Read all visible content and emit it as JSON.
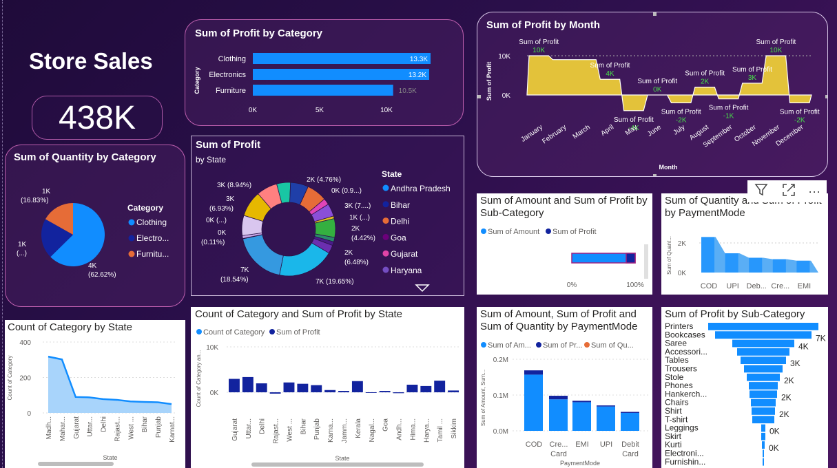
{
  "dashboard": {
    "title": "Store Sales",
    "kpi_value": "438K"
  },
  "icons": {
    "filter": "filter-icon",
    "focus": "focus-mode-icon",
    "more": "more-options-icon",
    "more_label": "···"
  },
  "colors": {
    "primary": "#118DFF",
    "navy": "#12239E",
    "orange": "#E66C37",
    "gold": "#E3C23A",
    "green": "#48E048"
  },
  "chart_data": [
    {
      "id": "profit_by_category",
      "type": "bar",
      "title": "Sum of Profit by Category",
      "ylabel": "Category",
      "categories": [
        "Clothing",
        "Electronics",
        "Furniture"
      ],
      "values": [
        13.3,
        13.2,
        10.5
      ],
      "data_labels": [
        "13.3K",
        "13.2K",
        "10.5K"
      ],
      "xticks": [
        "0K",
        "5K",
        "10K"
      ],
      "xlim": [
        0,
        13.3
      ]
    },
    {
      "id": "profit_by_month",
      "type": "area",
      "title": "Sum of Profit by Month",
      "xlabel": "Month",
      "ylabel": "Sum of Profit",
      "categories": [
        "January",
        "February",
        "March",
        "April",
        "May",
        "June",
        "July",
        "August",
        "September",
        "October",
        "November",
        "December"
      ],
      "values": [
        10,
        9,
        9,
        4,
        -4,
        0,
        -2,
        2,
        -1,
        3,
        10,
        -2
      ],
      "data_labels": [
        "10K",
        "",
        "",
        "4K",
        "-4K",
        "0K",
        "-2K",
        "2K",
        "-1K",
        "3K",
        "10K",
        "-2K"
      ],
      "annotations": [
        "Sum of Profit",
        "Sum of Profit",
        "Sum of Profit",
        "Sum of Profit",
        "Sum of Profit",
        "Sum of Profit",
        "Sum of Profit",
        "Sum of Profit",
        "Sum of Profit",
        "Sum of Profit"
      ],
      "yticks": [
        "10K",
        "0K"
      ],
      "grid": true
    },
    {
      "id": "quantity_by_category",
      "type": "pie",
      "title": "Sum of Quantity by Category",
      "legend_title": "Category",
      "labels": [
        "Clothing",
        "Electro...",
        "Furnitu..."
      ],
      "values": [
        62.62,
        20.55,
        16.83
      ],
      "data_labels": [
        "4K (62.62%)",
        "1K (...)",
        "1K (16.83%)"
      ]
    },
    {
      "id": "profit_by_state",
      "type": "pie",
      "title": "Sum of Profit",
      "subtitle": "by State",
      "legend_title": "State",
      "legend": [
        "Andhra Pradesh",
        "Bihar",
        "Delhi",
        "Goa",
        "Gujarat",
        "Haryana"
      ],
      "values": [
        19.65,
        18.54,
        6.93,
        8.94,
        4.76,
        6.48,
        4.42,
        0.9,
        0.11,
        2.5,
        3.0,
        2.2,
        1.6,
        3.0,
        5.0,
        4.0,
        7.95
      ],
      "data_labels": [
        "2K (4.76%)",
        "0K (0.9...)",
        "3K (7....)",
        "1K (...)",
        "2K (4.42%)",
        "2K (6.48%)",
        "7K (19.65%)",
        "7K (18.54%)",
        "0K (0.11%)",
        "0K (...)",
        "3K (6.93%)",
        "3K (8.94%)"
      ]
    },
    {
      "id": "amount_profit_by_subcategory",
      "type": "bar",
      "title": "Sum of Amount and Sum of Profit by Sub-Category",
      "legend": [
        "Sum of Amount",
        "Sum of Profit"
      ],
      "values": [
        1.0
      ],
      "xticks": [
        "0%",
        "100%"
      ]
    },
    {
      "id": "quantity_profit_by_paymentmode",
      "type": "area",
      "title": "Sum of Quantity and Sum of Profit by PaymentMode",
      "ylabel": "Sum of Quant...",
      "categories": [
        "COD",
        "UPI",
        "Deb...",
        "Cre...",
        "EMI"
      ],
      "values": [
        2.4,
        1.3,
        1.0,
        0.9,
        0.8
      ],
      "yticks": [
        "2K",
        "0K"
      ]
    },
    {
      "id": "count_by_state",
      "type": "area",
      "title": "Count of Category by State",
      "xlabel": "State",
      "ylabel": "Count of Category",
      "categories": [
        "Madh...",
        "Mahar...",
        "Gujarat",
        "Uttar...",
        "Delhi",
        "Rajast...",
        "West ...",
        "Bihar",
        "Punjab",
        "Karnat..."
      ],
      "values": [
        318,
        302,
        90,
        88,
        78,
        74,
        65,
        62,
        60,
        50
      ],
      "yticks": [
        "400",
        "200",
        "0"
      ],
      "ylim": [
        0,
        400
      ]
    },
    {
      "id": "count_profit_by_state",
      "type": "bar",
      "title": "Count of Category and Sum of Profit by State",
      "xlabel": "State",
      "ylabel": "Count of Category an...",
      "legend": [
        "Count of Category",
        "Sum of Profit"
      ],
      "categories": [
        "Gujarat",
        "Uttar...",
        "Delhi",
        "Rajast...",
        "West ...",
        "Bihar",
        "Punjab",
        "Karna...",
        "Jamm...",
        "Kerala",
        "Nagal...",
        "Goa",
        "Andh...",
        "Hima...",
        "Harya...",
        "Tamil ...",
        "Sikkim"
      ],
      "values": [
        3.0,
        3.4,
        2.0,
        -0.3,
        2.2,
        1.9,
        1.6,
        0.5,
        0.3,
        2.5,
        -0.1,
        0.3,
        -0.2,
        1.7,
        1.4,
        2.6,
        0.4
      ],
      "yticks": [
        "10K",
        "0K"
      ]
    },
    {
      "id": "amount_profit_qty_by_paymentmode",
      "type": "bar",
      "title": "Sum of Amount, Sum of Profit and Sum of Quantity by PaymentMode",
      "xlabel": "PaymentMode",
      "ylabel": "Sum of Amount, Sum...",
      "legend": [
        "Sum of Am...",
        "Sum of Pr...",
        "Sum of Qu..."
      ],
      "categories": [
        "COD",
        "Cre... Card",
        "EMI",
        "UPI",
        "Debit Card"
      ],
      "series": [
        {
          "name": "Sum of Amount",
          "values": [
            1.57,
            0.88,
            0.8,
            0.68,
            0.5
          ]
        },
        {
          "name": "Sum of Profit",
          "values": [
            0.12,
            0.1,
            0.04,
            0.03,
            0.03
          ]
        }
      ],
      "yticks": [
        "0.2M",
        "0.1M",
        "0.0M"
      ],
      "ylim": [
        0,
        0.2
      ]
    },
    {
      "id": "profit_by_subcategory",
      "type": "bar",
      "title": "Sum of Profit by Sub-Category",
      "categories": [
        "Printers",
        "Bookcases",
        "Saree",
        "Accessori...",
        "Tables",
        "Trousers",
        "Stole",
        "Phones",
        "Hankerch...",
        "Chairs",
        "Shirt",
        "T-shirt",
        "Leggings",
        "Skirt",
        "Kurti",
        "Electroni...",
        "Furnishin..."
      ],
      "values": [
        8.0,
        7.0,
        4.5,
        3.8,
        3.3,
        2.8,
        2.4,
        2.1,
        2.0,
        1.8,
        1.7,
        1.6,
        0.3,
        0.3,
        0.2,
        0.1,
        0.1
      ],
      "data_labels": [
        "",
        "7K",
        "4K",
        "",
        "3K",
        "",
        "2K",
        "",
        "2K",
        "",
        "2K",
        "",
        "0K",
        "",
        "0K",
        "",
        ""
      ]
    }
  ]
}
